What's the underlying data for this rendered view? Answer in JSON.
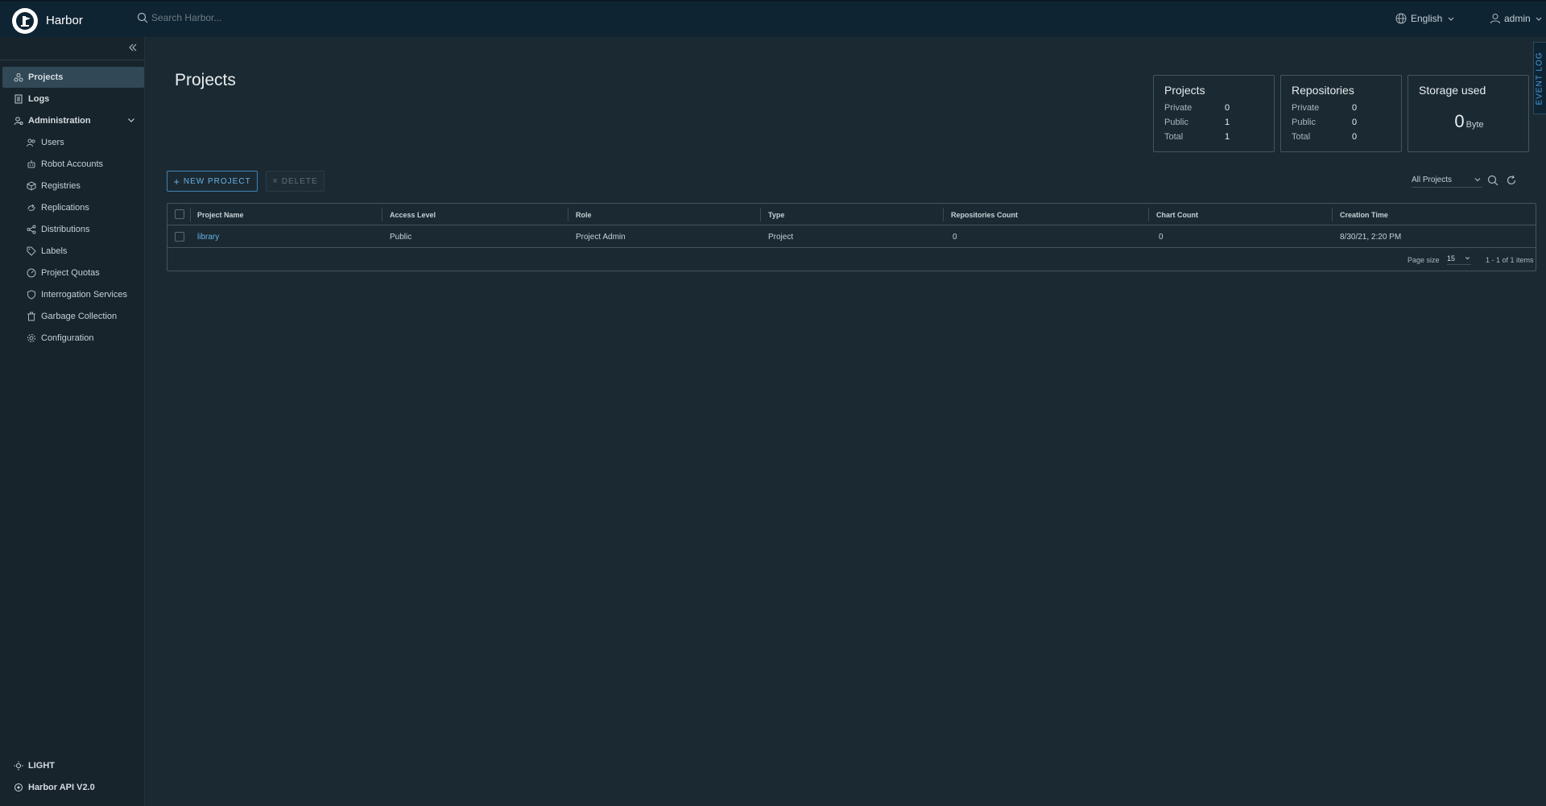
{
  "header": {
    "brand": "Harbor",
    "search_placeholder": "Search Harbor...",
    "language": "English",
    "user": "admin"
  },
  "sidebar": {
    "items": [
      {
        "label": "Projects"
      },
      {
        "label": "Logs"
      },
      {
        "label": "Administration"
      }
    ],
    "admin_items": [
      {
        "label": "Users"
      },
      {
        "label": "Robot Accounts"
      },
      {
        "label": "Registries"
      },
      {
        "label": "Replications"
      },
      {
        "label": "Distributions"
      },
      {
        "label": "Labels"
      },
      {
        "label": "Project Quotas"
      },
      {
        "label": "Interrogation Services"
      },
      {
        "label": "Garbage Collection"
      },
      {
        "label": "Configuration"
      }
    ],
    "theme_toggle": "LIGHT",
    "api_link": "Harbor API V2.0"
  },
  "event_log": "EVENT LOG",
  "page_title": "Projects",
  "summary": {
    "projects": {
      "title": "Projects",
      "private_label": "Private",
      "private": "0",
      "public_label": "Public",
      "public": "1",
      "total_label": "Total",
      "total": "1"
    },
    "repositories": {
      "title": "Repositories",
      "private_label": "Private",
      "private": "0",
      "public_label": "Public",
      "public": "0",
      "total_label": "Total",
      "total": "0"
    },
    "storage": {
      "title": "Storage used",
      "value": "0",
      "unit": "Byte"
    }
  },
  "toolbar": {
    "new_project": "NEW PROJECT",
    "delete": "DELETE",
    "filter": "All Projects"
  },
  "table": {
    "columns": [
      "Project Name",
      "Access Level",
      "Role",
      "Type",
      "Repositories Count",
      "Chart Count",
      "Creation Time"
    ],
    "rows": [
      [
        "library",
        "Public",
        "Project Admin",
        "Project",
        "0",
        "0",
        "8/30/21, 2:20 PM"
      ]
    ],
    "page_size_label": "Page size",
    "page_size": "15",
    "count_text": "1 - 1 of 1 items"
  }
}
